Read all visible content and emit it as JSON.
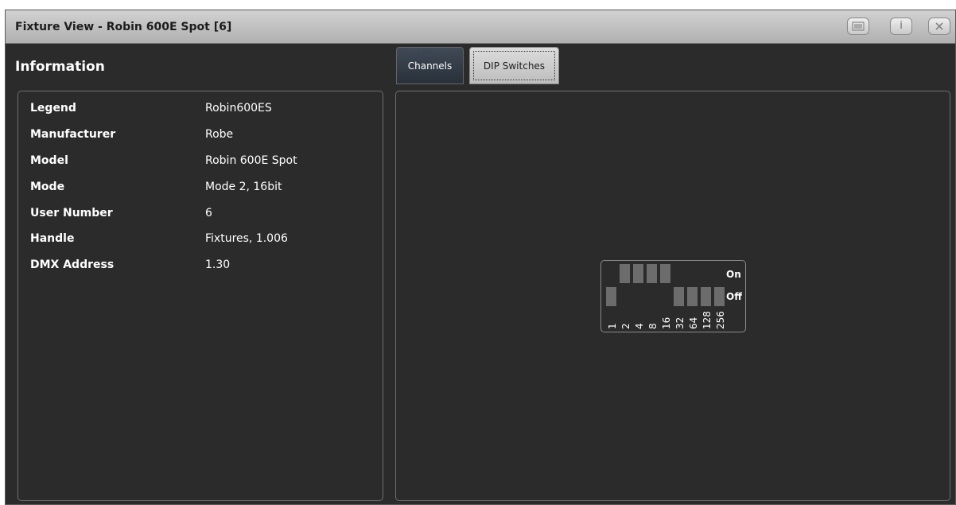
{
  "window": {
    "title": "Fixture View - Robin 600E Spot [6]",
    "buttons": [
      {
        "name": "menu-icon"
      },
      {
        "name": "info-icon",
        "label": "i"
      },
      {
        "name": "close-icon"
      }
    ]
  },
  "information": {
    "heading": "Information",
    "rows": [
      {
        "label": "Legend",
        "value": "Robin600ES"
      },
      {
        "label": "Manufacturer",
        "value": "Robe"
      },
      {
        "label": "Model",
        "value": "Robin 600E Spot"
      },
      {
        "label": "Mode",
        "value": "Mode 2, 16bit"
      },
      {
        "label": "User Number",
        "value": "6"
      },
      {
        "label": "Handle",
        "value": "Fixtures, 1.006"
      },
      {
        "label": "DMX Address",
        "value": "1.30"
      }
    ]
  },
  "tabs": [
    {
      "label": "Channels",
      "selected": false
    },
    {
      "label": "DIP Switches",
      "selected": true
    }
  ],
  "dip_switches": {
    "on_label": "On",
    "off_label": "Off",
    "switches": [
      {
        "label": "1",
        "state": "off"
      },
      {
        "label": "2",
        "state": "on"
      },
      {
        "label": "4",
        "state": "on"
      },
      {
        "label": "8",
        "state": "on"
      },
      {
        "label": "16",
        "state": "on"
      },
      {
        "label": "32",
        "state": "off"
      },
      {
        "label": "64",
        "state": "off"
      },
      {
        "label": "128",
        "state": "off"
      },
      {
        "label": "256",
        "state": "off"
      }
    ]
  },
  "colors": {
    "window_bg": "#2b2b2b",
    "switch": "#6c6c6c",
    "tab_selected": "#c8c8c8",
    "tab_unselected": "#323a44"
  }
}
